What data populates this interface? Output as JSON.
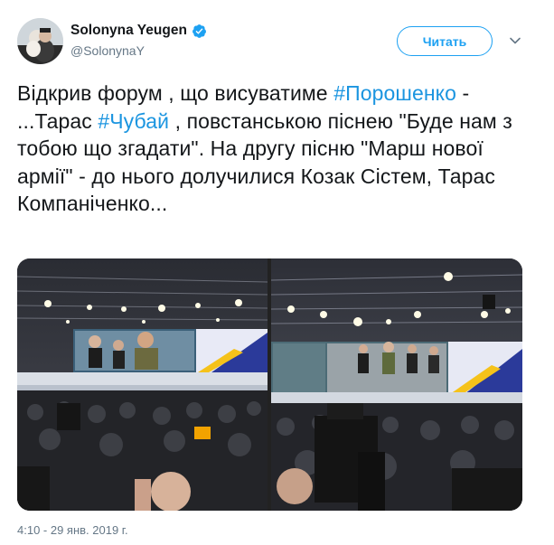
{
  "user": {
    "display_name": "Solonyna Yeugen",
    "screen_name": "@SolonynaY",
    "verified": true,
    "avatar_icon": "avatar-photo-icon"
  },
  "follow_button": {
    "label": "Читать"
  },
  "tweet": {
    "segments": [
      {
        "type": "text",
        "value": "Відкрив форум , що висуватиме "
      },
      {
        "type": "hashtag",
        "value": "#Порошенко"
      },
      {
        "type": "text",
        "value": " - ...Тарас "
      },
      {
        "type": "hashtag",
        "value": "#Чубай"
      },
      {
        "type": "text",
        "value": " , повстанською піснею \"Буде нам з тобою що згадати\". На другу пісню \"Марш нової армії\" - до нього долучилися Козак Сістем, Тарас Компаніченко..."
      }
    ]
  },
  "media": {
    "photos": [
      {
        "name": "photo-stage-singer"
      },
      {
        "name": "photo-stage-band"
      }
    ]
  },
  "timestamp": "4:10 - 29 янв. 2019 г.",
  "colors": {
    "accent": "#1da1f2",
    "hashtag": "#1b95e0",
    "secondary_text": "#657786",
    "primary_text": "#14171a"
  }
}
